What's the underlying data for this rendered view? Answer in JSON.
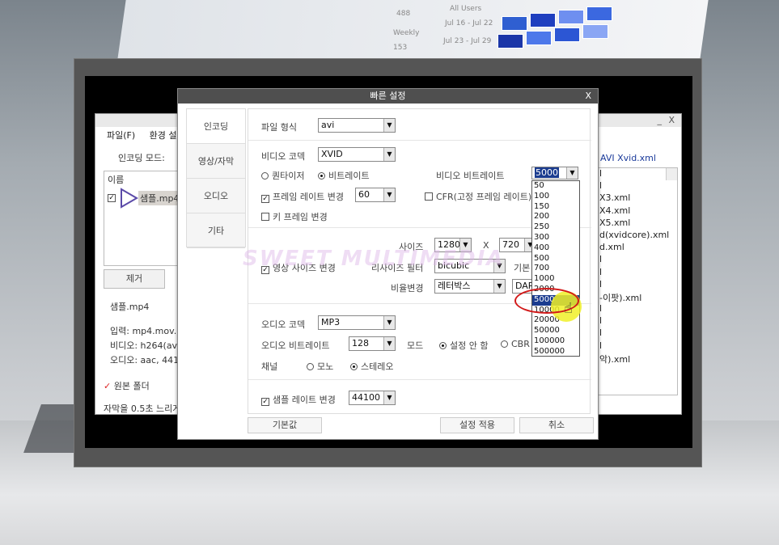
{
  "background": {
    "page_texts": [
      "488",
      "Weekly",
      "153"
    ],
    "chart_texts": [
      "All Users",
      "Jul 16 - Jul 22",
      "Jul 23 - Jul 29"
    ]
  },
  "app": {
    "menu": [
      "파일(F)",
      "환경 설정"
    ],
    "encoding_mode_label": "인코딩 모드:",
    "list_header": "이름",
    "file_name": "샘플.mp4",
    "remove_button": "제거",
    "info_title": "샘플.mp4",
    "info_lines": [
      "입력: mp4.mov.3g",
      "비디오: h264(avc1",
      "오디오: aac, 4410"
    ],
    "keep_folder_label": "원본 폴더",
    "status_text": "자막을 0.5초 느리게",
    "profile_title": "AVI Xvid.xml",
    "profile_items": [
      "l",
      "l",
      "X3.xml",
      "X4.xml",
      "X5.xml",
      "d(xvidcore).xml",
      "d.xml",
      "l",
      "l",
      "l",
      "-이팟).xml",
      "l",
      "l",
      "l",
      "l",
      "악).xml"
    ],
    "window_controls": [
      "_",
      "X"
    ]
  },
  "dialog": {
    "title": "빠른 설정",
    "close": "X",
    "tabs": [
      "인코딩",
      "영상/자막",
      "오디오",
      "기타"
    ],
    "file_format_label": "파일 형식",
    "file_format_value": "avi",
    "video_codec_label": "비디오 코덱",
    "video_codec_value": "XVID",
    "quantizer_label": "퀀타이저",
    "bitrate_label": "비트레이트",
    "video_bitrate_label": "비디오 비트레이트",
    "video_bitrate_value": "5000",
    "framerate_change_label": "프레임 레이트 변경",
    "framerate_value": "60",
    "cfr_label": "CFR(고정 프레임 레이트)",
    "keyframe_change_label": "키 프레임 변경",
    "size_label": "사이즈",
    "width_value": "1280",
    "x_label": "X",
    "height_value": "720",
    "resize_change_label": "영상 사이즈 변경",
    "resize_filter_label": "리사이즈 필터",
    "resize_filter_value": "bicubic",
    "base_label_partial": "기본",
    "ratio_label": "비율변경",
    "ratio_value": "레터박스",
    "dar_partial": "DAR",
    "audio_codec_label": "오디오 코덱",
    "audio_codec_value": "MP3",
    "audio_bitrate_label": "오디오 비트레이트",
    "audio_bitrate_value": "128",
    "mode_label": "모드",
    "mode_none_label": "설정 안 함",
    "cbr_label": "CBR",
    "channel_label": "채널",
    "mono_label": "모노",
    "stereo_label": "스테레오",
    "samplerate_change_label": "샘플 레이트 변경",
    "samplerate_value": "44100",
    "default_button": "기본값",
    "apply_button": "설정 적용",
    "cancel_button": "취소",
    "bitrate_options": [
      "50",
      "100",
      "150",
      "200",
      "250",
      "300",
      "400",
      "500",
      "700",
      "1000",
      "2000",
      "5000",
      "10000",
      "20000",
      "50000",
      "100000",
      "500000"
    ],
    "bitrate_selected": "5000"
  },
  "watermark": "SWEET MULTIMEDIA"
}
